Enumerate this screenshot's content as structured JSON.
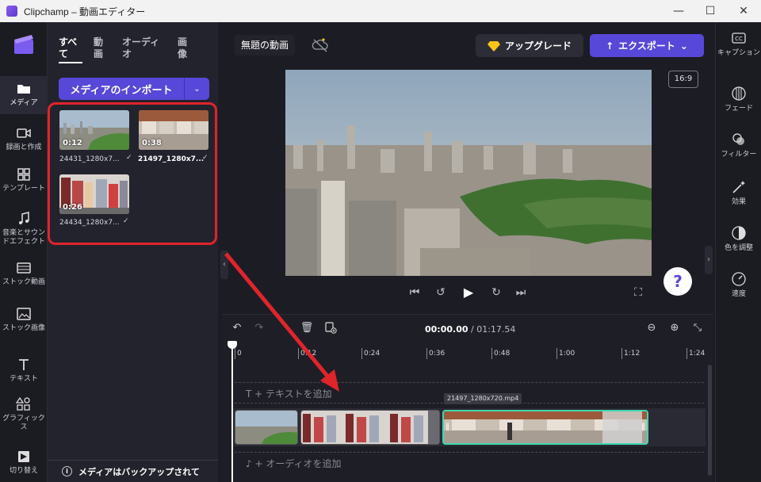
{
  "window": {
    "title": "Clipchamp – 動画エディター",
    "minimize": "—",
    "maximize": "☐",
    "close": "✕"
  },
  "nav": {
    "items": [
      {
        "label": "メディア",
        "icon": "folder-icon"
      },
      {
        "label": "録画と作成",
        "icon": "camera-icon"
      },
      {
        "label": "テンプレート",
        "icon": "template-icon"
      },
      {
        "label": "音楽とサウンドエフェクト",
        "icon": "music-icon"
      },
      {
        "label": "ストック動画",
        "icon": "film-icon"
      },
      {
        "label": "ストック画像",
        "icon": "image-icon"
      },
      {
        "label": "テキスト",
        "icon": "text-icon"
      },
      {
        "label": "グラフィックス",
        "icon": "shapes-icon"
      },
      {
        "label": "切り替え",
        "icon": "transition-icon"
      }
    ]
  },
  "media": {
    "tabs": [
      "すべて",
      "動画",
      "オーディオ",
      "画像"
    ],
    "import_label": "メディアのインポート",
    "import_dropdown": "⌄",
    "items": [
      {
        "duration": "0:12",
        "name": "24431_1280x7...",
        "check": "✓"
      },
      {
        "duration": "0:38",
        "name": "21497_1280x7...",
        "check": "✓"
      },
      {
        "duration": "0:26",
        "name": "24434_1280x7...",
        "check": "✓"
      }
    ],
    "backup_text": "メディアはバックアップされて",
    "backup_info": "i",
    "collapse": "‹"
  },
  "header": {
    "project_name": "無題の動画",
    "upgrade_label": "アップグレード",
    "export_label": "エクスポート",
    "export_dropdown": "⌄",
    "export_icon": "↑"
  },
  "preview": {
    "aspect_ratio": "16:9"
  },
  "playback": {
    "skip_back": "⏮",
    "rewind": "↺",
    "play": "▶",
    "forward": "↻",
    "skip_forward": "⏭",
    "fullscreen": "⛶",
    "help": "?",
    "collapse": "›"
  },
  "rightpanel": {
    "items": [
      {
        "label": "キャプション",
        "icon": "cc-icon"
      },
      {
        "label": "フェード",
        "icon": "fade-icon"
      },
      {
        "label": "フィルター",
        "icon": "filter-icon"
      },
      {
        "label": "効果",
        "icon": "magic-wand-icon"
      },
      {
        "label": "色を調整",
        "icon": "contrast-icon"
      },
      {
        "label": "速度",
        "icon": "speedometer-icon"
      }
    ]
  },
  "timeline": {
    "current_time": "00:00.00",
    "total_time": "/ 01:17.54",
    "undo": "↶",
    "redo": "↷",
    "delete": "🗑",
    "zoom_out": "⊖",
    "zoom_in": "⊕",
    "fit": "⤡",
    "ruler_ticks": [
      "0",
      "0:12",
      "0:24",
      "0:36",
      "0:48",
      "1:00",
      "1:12",
      "1:24"
    ],
    "add_text": "T  + テキストを追加",
    "add_audio": "♪  + オーディオを追加",
    "clip_tag": "21497_1280x720.mp4"
  },
  "colors": {
    "accent": "#5848d9",
    "annotation": "#e0242c",
    "selected_clip": "#3fd7b0"
  }
}
